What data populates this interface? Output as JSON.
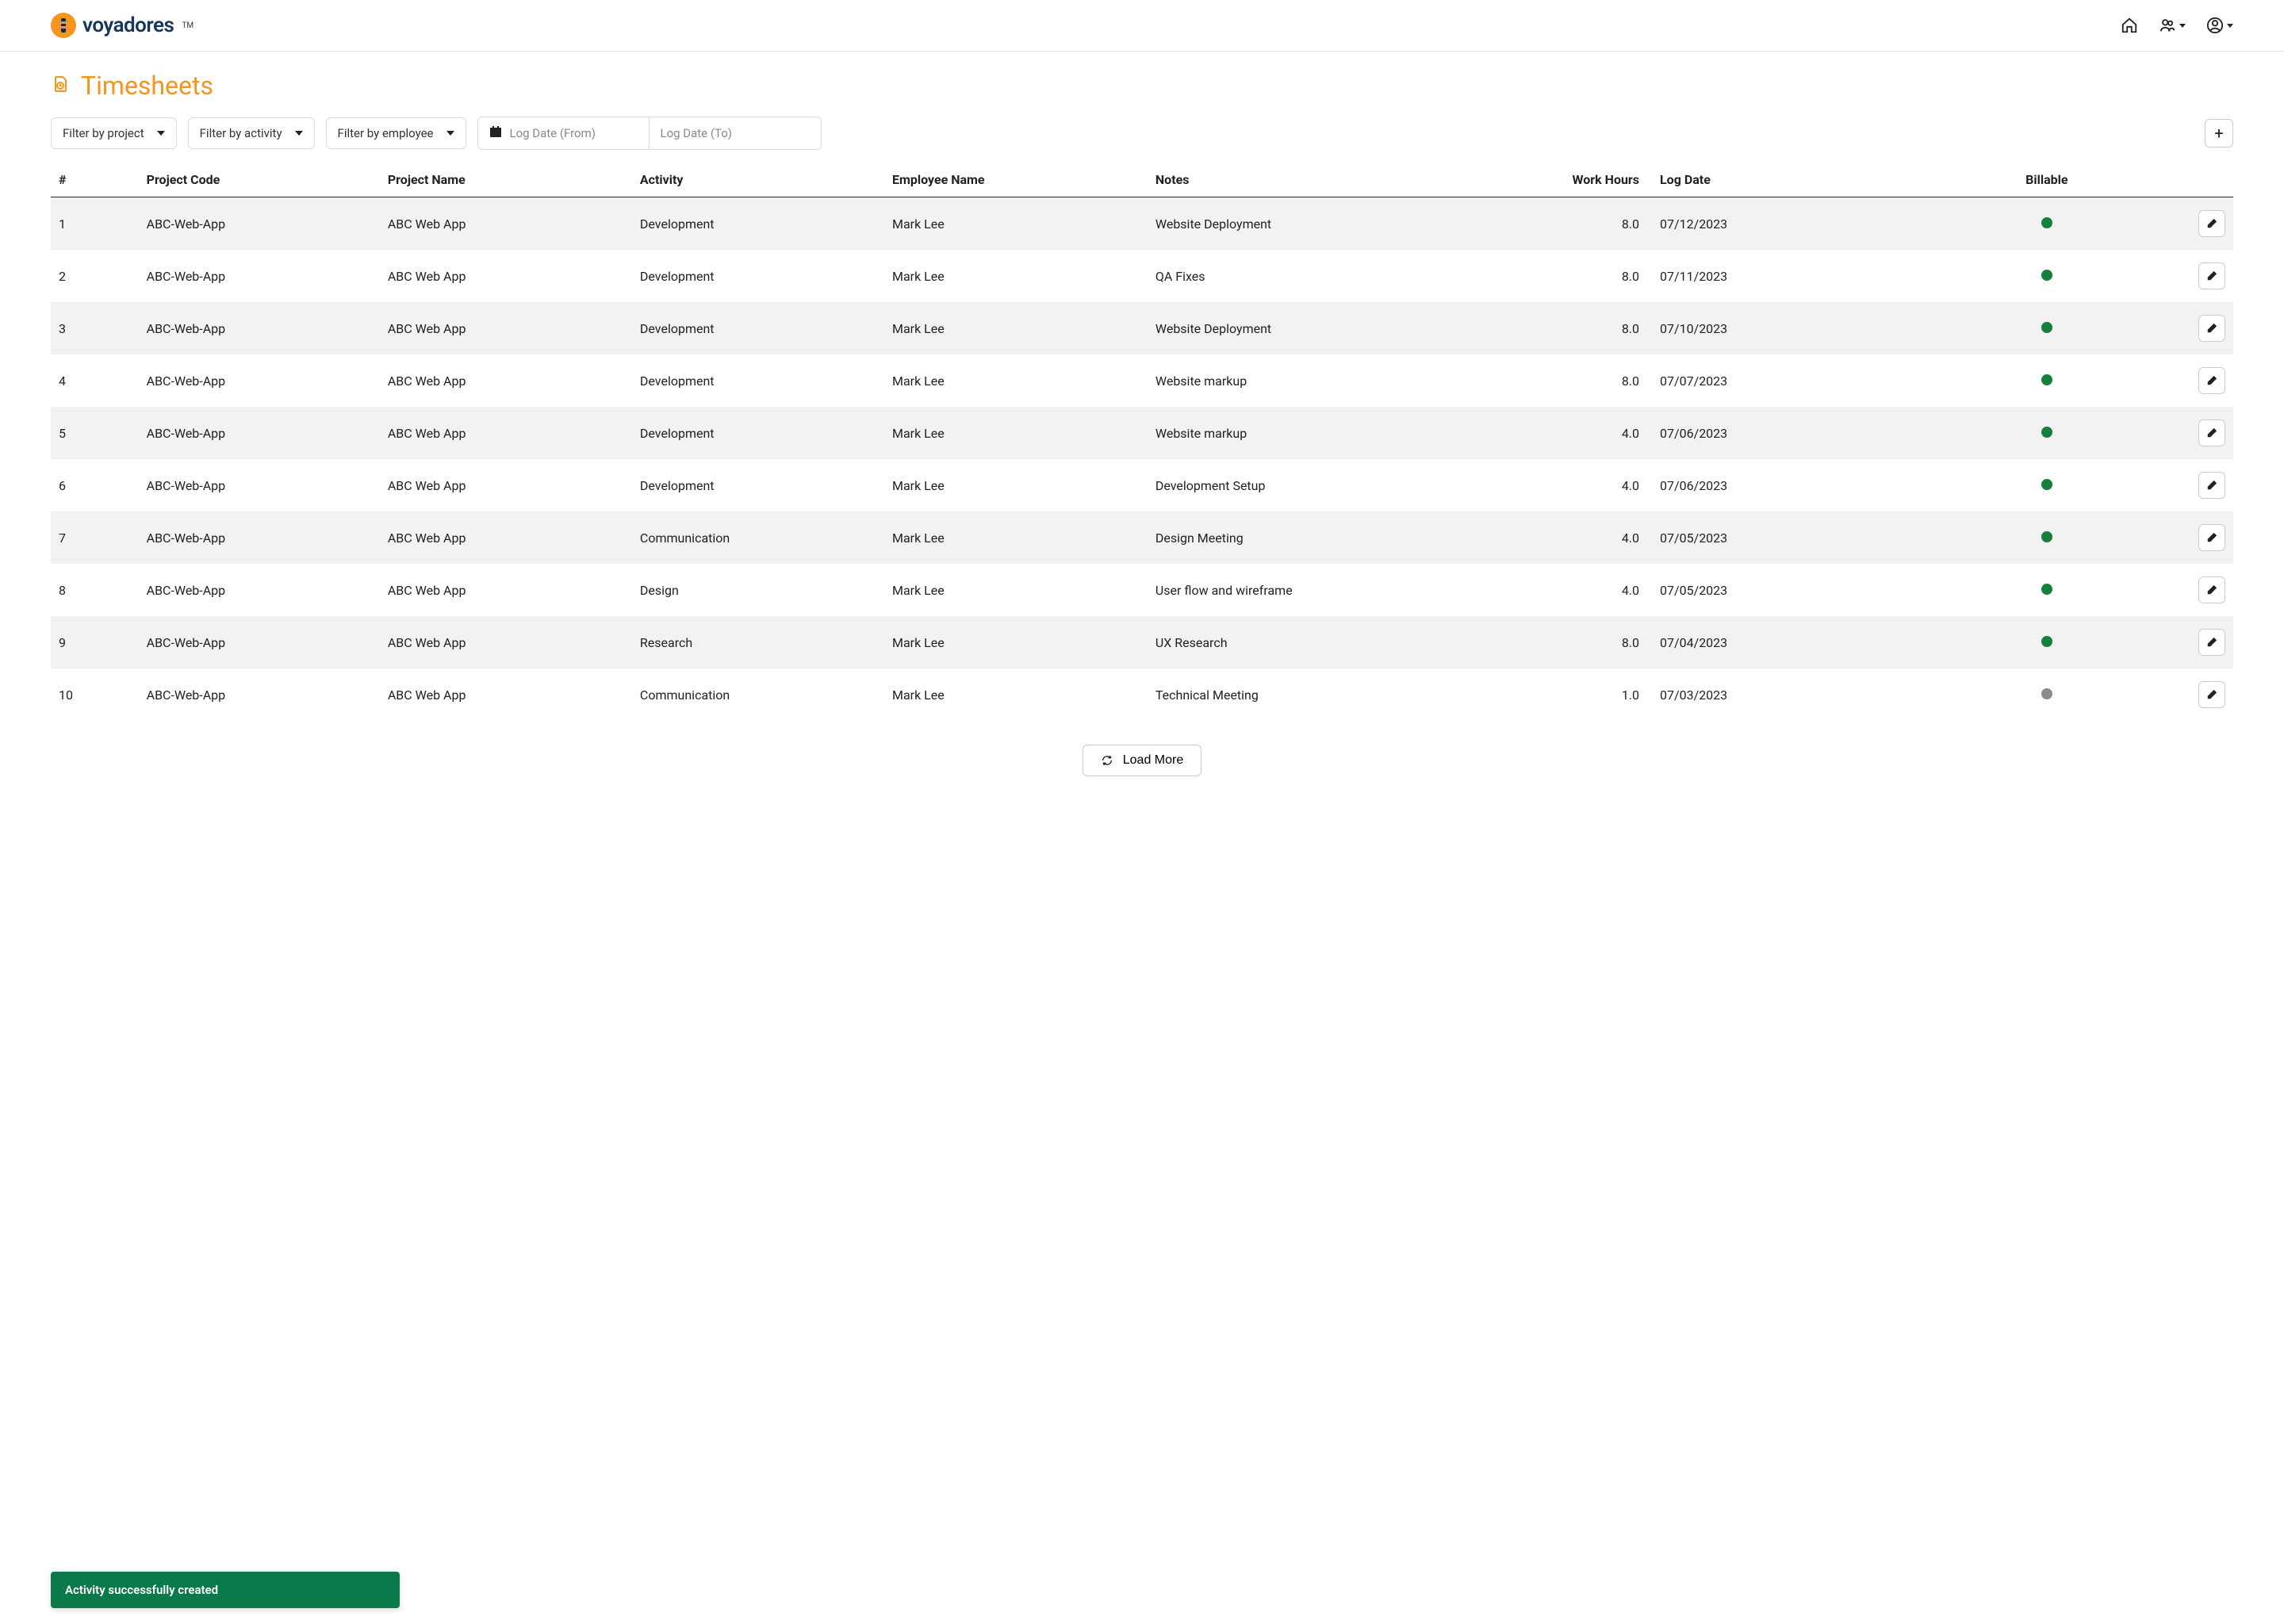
{
  "brand": {
    "name": "voyadores",
    "tm": "TM"
  },
  "page": {
    "title": "Timesheets"
  },
  "filters": {
    "project": "Filter by project",
    "activity": "Filter by activity",
    "employee": "Filter by employee",
    "date_from_placeholder": "Log Date (From)",
    "date_to_placeholder": "Log Date (To)"
  },
  "columns": {
    "num": "#",
    "project_code": "Project Code",
    "project_name": "Project Name",
    "activity": "Activity",
    "employee_name": "Employee Name",
    "notes": "Notes",
    "work_hours": "Work Hours",
    "log_date": "Log Date",
    "billable": "Billable"
  },
  "rows": [
    {
      "num": "1",
      "code": "ABC-Web-App",
      "name": "ABC Web App",
      "activity": "Development",
      "employee": "Mark Lee",
      "notes": "Website Deployment",
      "hours": "8.0",
      "date": "07/12/2023",
      "billable": true
    },
    {
      "num": "2",
      "code": "ABC-Web-App",
      "name": "ABC Web App",
      "activity": "Development",
      "employee": "Mark Lee",
      "notes": "QA Fixes",
      "hours": "8.0",
      "date": "07/11/2023",
      "billable": true
    },
    {
      "num": "3",
      "code": "ABC-Web-App",
      "name": "ABC Web App",
      "activity": "Development",
      "employee": "Mark Lee",
      "notes": "Website Deployment",
      "hours": "8.0",
      "date": "07/10/2023",
      "billable": true
    },
    {
      "num": "4",
      "code": "ABC-Web-App",
      "name": "ABC Web App",
      "activity": "Development",
      "employee": "Mark Lee",
      "notes": "Website markup",
      "hours": "8.0",
      "date": "07/07/2023",
      "billable": true
    },
    {
      "num": "5",
      "code": "ABC-Web-App",
      "name": "ABC Web App",
      "activity": "Development",
      "employee": "Mark Lee",
      "notes": "Website markup",
      "hours": "4.0",
      "date": "07/06/2023",
      "billable": true
    },
    {
      "num": "6",
      "code": "ABC-Web-App",
      "name": "ABC Web App",
      "activity": "Development",
      "employee": "Mark Lee",
      "notes": "Development Setup",
      "hours": "4.0",
      "date": "07/06/2023",
      "billable": true
    },
    {
      "num": "7",
      "code": "ABC-Web-App",
      "name": "ABC Web App",
      "activity": "Communication",
      "employee": "Mark Lee",
      "notes": "Design Meeting",
      "hours": "4.0",
      "date": "07/05/2023",
      "billable": true
    },
    {
      "num": "8",
      "code": "ABC-Web-App",
      "name": "ABC Web App",
      "activity": "Design",
      "employee": "Mark Lee",
      "notes": "User flow and wireframe",
      "hours": "4.0",
      "date": "07/05/2023",
      "billable": true
    },
    {
      "num": "9",
      "code": "ABC-Web-App",
      "name": "ABC Web App",
      "activity": "Research",
      "employee": "Mark Lee",
      "notes": "UX Research",
      "hours": "8.0",
      "date": "07/04/2023",
      "billable": true
    },
    {
      "num": "10",
      "code": "ABC-Web-App",
      "name": "ABC Web App",
      "activity": "Communication",
      "employee": "Mark Lee",
      "notes": "Technical Meeting",
      "hours": "1.0",
      "date": "07/03/2023",
      "billable": false
    }
  ],
  "load_more": "Load More",
  "toast": {
    "message": "Activity successfully created"
  },
  "colors": {
    "billable_true": "#15803d",
    "billable_false": "#8b8b8b",
    "accent": "#f5941e",
    "brand_text": "#16365b",
    "toast_bg": "#0a7a4b"
  }
}
